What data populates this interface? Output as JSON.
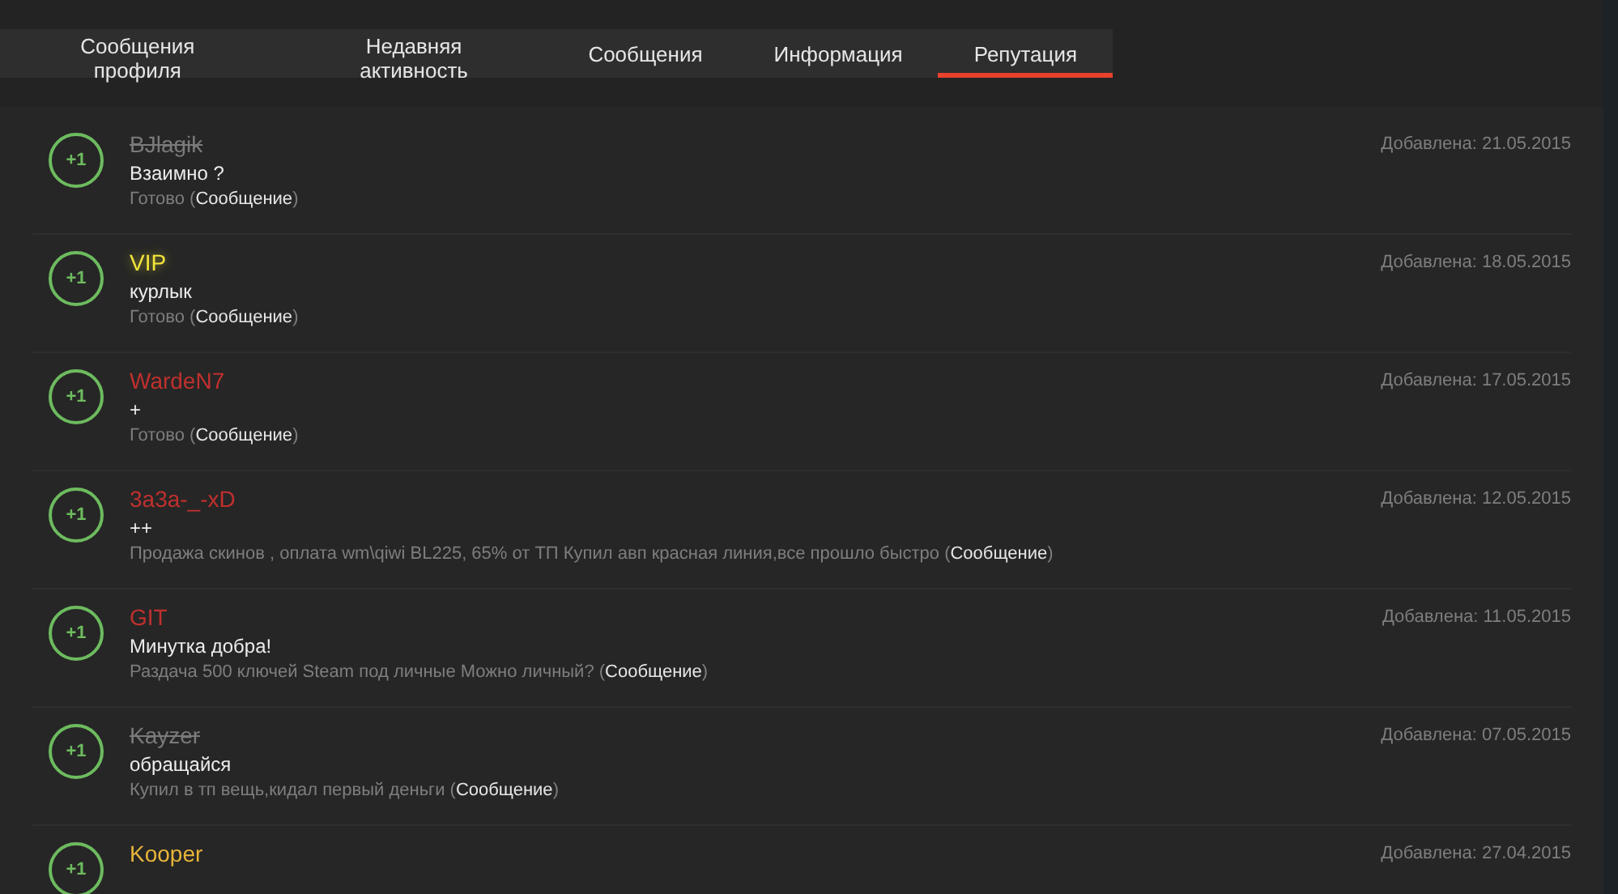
{
  "tabs": [
    {
      "label": "Сообщения профиля",
      "selected": false
    },
    {
      "label": "Недавняя активность",
      "selected": false
    },
    {
      "label": "Сообщения",
      "selected": false
    },
    {
      "label": "Информация",
      "selected": false
    },
    {
      "label": "Репутация",
      "selected": true
    }
  ],
  "reputation": [
    {
      "score": "+1",
      "name": "BJlagik",
      "color": "#7a7a7a",
      "banned": true,
      "highlighted": false,
      "comment": "Взаимно ?",
      "note": "Готово (",
      "link": "Сообщение",
      "note_close": ")",
      "date": "Добавлена: 21.05.2015"
    },
    {
      "score": "+1",
      "name": "VIP",
      "color": "#f2e53a",
      "banned": false,
      "highlighted": true,
      "comment": "курлык",
      "note": "Готово (",
      "link": "Сообщение",
      "note_close": ")",
      "date": "Добавлена: 18.05.2015"
    },
    {
      "score": "+1",
      "name": "WardeN7",
      "color": "#c0302e",
      "banned": false,
      "highlighted": false,
      "comment": "+",
      "note": "Готово (",
      "link": "Сообщение",
      "note_close": ")",
      "date": "Добавлена: 17.05.2015"
    },
    {
      "score": "+1",
      "name": "3a3a-_-xD",
      "color": "#c0302e",
      "banned": false,
      "highlighted": false,
      "comment": "++",
      "note": "Продажа скинов , оплата wm\\qiwi BL225, 65% от ТП Купил авп красная линия,все прошло быстро (",
      "link": "Сообщение",
      "note_close": ")",
      "date": "Добавлена: 12.05.2015"
    },
    {
      "score": "+1",
      "name": "GIT",
      "color": "#c0302e",
      "banned": false,
      "highlighted": false,
      "comment": "Минутка добра!",
      "note": "Раздача 500 ключей Steam под личные Можно личный? (",
      "link": "Сообщение",
      "note_close": ")",
      "date": "Добавлена: 11.05.2015"
    },
    {
      "score": "+1",
      "name": "Kayzer",
      "color": "#7a7a7a",
      "banned": true,
      "highlighted": false,
      "comment": "обращайся",
      "note": "Купил в тп вещь,кидал первый деньги (",
      "link": "Сообщение",
      "note_close": ")",
      "date": "Добавлена: 07.05.2015"
    },
    {
      "score": "+1",
      "name": "Kooper",
      "color": "#e8b53a",
      "banned": false,
      "highlighted": false,
      "date": "Добавлена: 27.04.2015"
    }
  ]
}
